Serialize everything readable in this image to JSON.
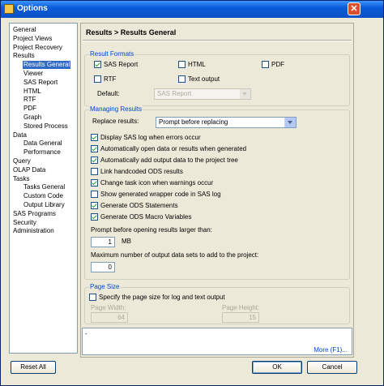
{
  "window": {
    "title": "Options",
    "close_glyph": "✕"
  },
  "tree": {
    "items": [
      {
        "label": "General",
        "indent": 0
      },
      {
        "label": "Project Views",
        "indent": 0
      },
      {
        "label": "Project Recovery",
        "indent": 0
      },
      {
        "label": "Results",
        "indent": 0
      },
      {
        "label": "Results General",
        "indent": 1,
        "selected": true
      },
      {
        "label": "Viewer",
        "indent": 1
      },
      {
        "label": "SAS Report",
        "indent": 1
      },
      {
        "label": "HTML",
        "indent": 1
      },
      {
        "label": "RTF",
        "indent": 1
      },
      {
        "label": "PDF",
        "indent": 1
      },
      {
        "label": "Graph",
        "indent": 1
      },
      {
        "label": "Stored Process",
        "indent": 1
      },
      {
        "label": "Data",
        "indent": 0
      },
      {
        "label": "Data General",
        "indent": 1
      },
      {
        "label": "Performance",
        "indent": 1
      },
      {
        "label": "Query",
        "indent": 0
      },
      {
        "label": "OLAP Data",
        "indent": 0
      },
      {
        "label": "Tasks",
        "indent": 0
      },
      {
        "label": "Tasks General",
        "indent": 1
      },
      {
        "label": "Custom Code",
        "indent": 1
      },
      {
        "label": "Output Library",
        "indent": 1
      },
      {
        "label": "SAS Programs",
        "indent": 0
      },
      {
        "label": "Security",
        "indent": 0
      },
      {
        "label": "Administration",
        "indent": 0
      }
    ]
  },
  "panel": {
    "title": "Results > Results General",
    "result_formats": {
      "label": "Result Formats",
      "sas_report": {
        "label": "SAS Report",
        "checked": true
      },
      "html": {
        "label": "HTML",
        "checked": false
      },
      "pdf": {
        "label": "PDF",
        "checked": false
      },
      "rtf": {
        "label": "RTF",
        "checked": false
      },
      "text_output": {
        "label": "Text output",
        "checked": false
      },
      "default_label": "Default:",
      "default_value": "SAS Report"
    },
    "managing": {
      "label": "Managing Results",
      "replace_label": "Replace results:",
      "replace_value": "Prompt before replacing",
      "options": [
        {
          "label": "Display SAS log when errors occur",
          "checked": true
        },
        {
          "label": "Automatically open data or results when generated",
          "checked": true
        },
        {
          "label": "Automatically add output data to the project tree",
          "checked": true
        },
        {
          "label": "Link handcoded ODS results",
          "checked": false
        },
        {
          "label": "Change task icon when warnings occur",
          "checked": true
        },
        {
          "label": "Show generated wrapper code in SAS log",
          "checked": false
        },
        {
          "label": "Generate ODS Statements",
          "checked": true
        },
        {
          "label": "Generate ODS Macro Variables",
          "checked": true
        }
      ],
      "prompt_label": "Prompt before opening results larger than:",
      "prompt_value": "1",
      "prompt_unit": "MB",
      "max_label": "Maximum number of output data sets to add to the project:",
      "max_value": "0"
    },
    "page_size": {
      "label": "Page Size",
      "specify_label": "Specify the page size for log and text output",
      "specify_checked": false,
      "width_label": "Page Width:",
      "width_value": "64",
      "height_label": "Page Height:",
      "height_value": "15"
    }
  },
  "help": {
    "mark": "-",
    "more_label": "More (F1)..."
  },
  "buttons": {
    "reset": "Reset All",
    "ok": "OK",
    "cancel": "Cancel"
  }
}
